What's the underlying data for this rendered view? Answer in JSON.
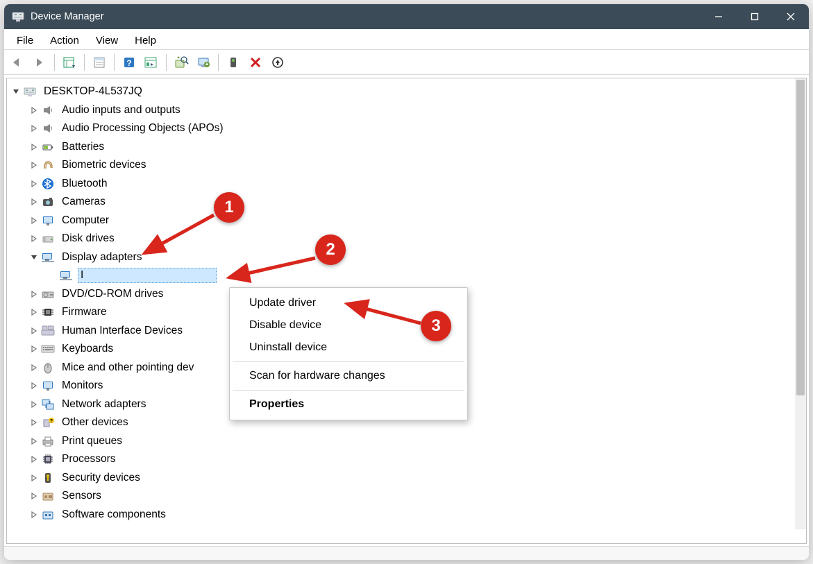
{
  "window": {
    "title": "Device Manager"
  },
  "menu": {
    "file": "File",
    "action": "Action",
    "view": "View",
    "help": "Help"
  },
  "toolbar_icons": {
    "back": "back-icon",
    "forward": "forward-icon",
    "show_hide": "show-hide-tree-icon",
    "properties": "properties-sheet-icon",
    "help": "help-icon",
    "details": "details-pane-icon",
    "scan": "scan-hardware-icon",
    "update": "update-driver-icon",
    "enable": "enable-device-icon",
    "disable": "disable-device-icon",
    "uninstall": "uninstall-device-icon"
  },
  "tree": {
    "root": "DESKTOP-4L537JQ",
    "items": [
      {
        "label": "Audio inputs and outputs",
        "icon": "speaker-icon"
      },
      {
        "label": "Audio Processing Objects (APOs)",
        "icon": "speaker-icon"
      },
      {
        "label": "Batteries",
        "icon": "battery-icon"
      },
      {
        "label": "Biometric devices",
        "icon": "fingerprint-icon"
      },
      {
        "label": "Bluetooth",
        "icon": "bluetooth-icon"
      },
      {
        "label": "Cameras",
        "icon": "camera-icon"
      },
      {
        "label": "Computer",
        "icon": "monitor-icon"
      },
      {
        "label": "Disk drives",
        "icon": "disk-icon"
      },
      {
        "label": "Display adapters",
        "icon": "display-adapter-icon",
        "expanded": true,
        "children": [
          {
            "label": "I",
            "icon": "display-adapter-icon",
            "selected": true
          }
        ]
      },
      {
        "label": "DVD/CD-ROM drives",
        "icon": "optical-drive-icon"
      },
      {
        "label": "Firmware",
        "icon": "chip-icon"
      },
      {
        "label": "Human Interface Devices",
        "icon": "hid-icon"
      },
      {
        "label": "Keyboards",
        "icon": "keyboard-icon"
      },
      {
        "label": "Mice and other pointing dev",
        "icon": "mouse-icon"
      },
      {
        "label": "Monitors",
        "icon": "monitor-icon"
      },
      {
        "label": "Network adapters",
        "icon": "network-icon"
      },
      {
        "label": "Other devices",
        "icon": "unknown-device-icon"
      },
      {
        "label": "Print queues",
        "icon": "printer-icon"
      },
      {
        "label": "Processors",
        "icon": "cpu-icon"
      },
      {
        "label": "Security devices",
        "icon": "security-icon"
      },
      {
        "label": "Sensors",
        "icon": "sensor-icon"
      },
      {
        "label": "Software components",
        "icon": "software-component-icon"
      }
    ]
  },
  "context_menu": {
    "update": "Update driver",
    "disable": "Disable device",
    "uninstall": "Uninstall device",
    "scan": "Scan for hardware changes",
    "properties": "Properties"
  },
  "annotations": {
    "b1": "1",
    "b2": "2",
    "b3": "3"
  }
}
